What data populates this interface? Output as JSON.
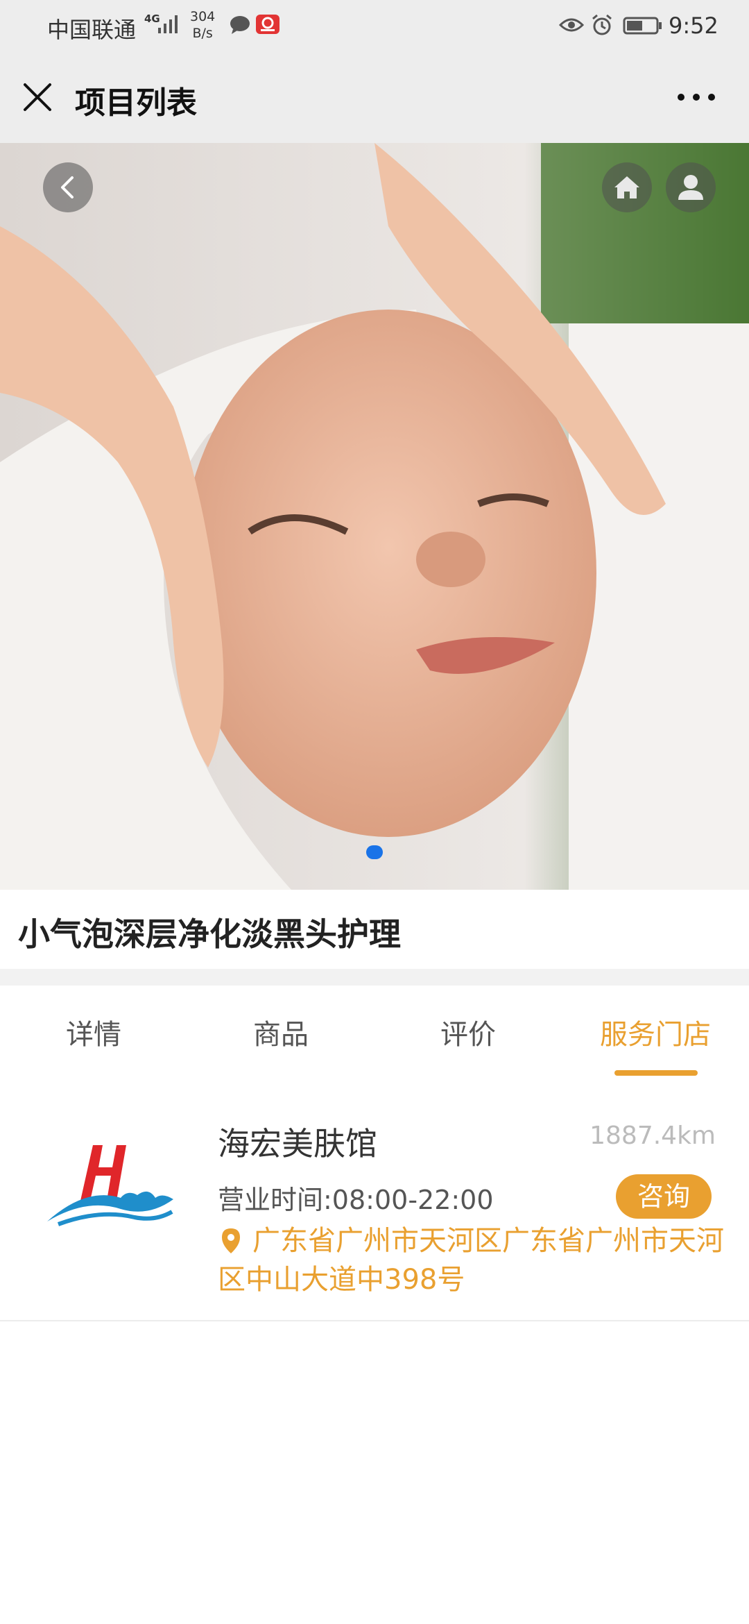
{
  "status_bar": {
    "carrier": "中国联通",
    "network_type": "4G",
    "speed_value": "304",
    "speed_unit": "B/s",
    "time": "9:52",
    "icons": [
      "signal-icon",
      "message-icon",
      "app-icon",
      "eye-icon",
      "alarm-icon",
      "battery-icon"
    ]
  },
  "nav": {
    "title": "项目列表",
    "close_icon": "close-icon",
    "more_icon": "more-icon"
  },
  "hero": {
    "icons": [
      "back-icon",
      "home-icon",
      "user-icon"
    ],
    "carousel_dots": 1,
    "active_dot": 1
  },
  "product": {
    "title": "小气泡深层净化淡黑头护理"
  },
  "tabs": [
    {
      "label": "详情",
      "active": false
    },
    {
      "label": "商品",
      "active": false
    },
    {
      "label": "评价",
      "active": false
    },
    {
      "label": "服务门店",
      "active": true
    }
  ],
  "store": {
    "name": "海宏美肤馆",
    "distance": "1887.4km",
    "hours": "营业时间:08:00-22:00",
    "consult_label": "咨询",
    "address": "广东省广州市天河区广东省广州市天河区中山大道中398号"
  },
  "colors": {
    "accent": "#e9a030",
    "header_bg": "#ededed",
    "carousel_dot": "#1a73e8"
  }
}
